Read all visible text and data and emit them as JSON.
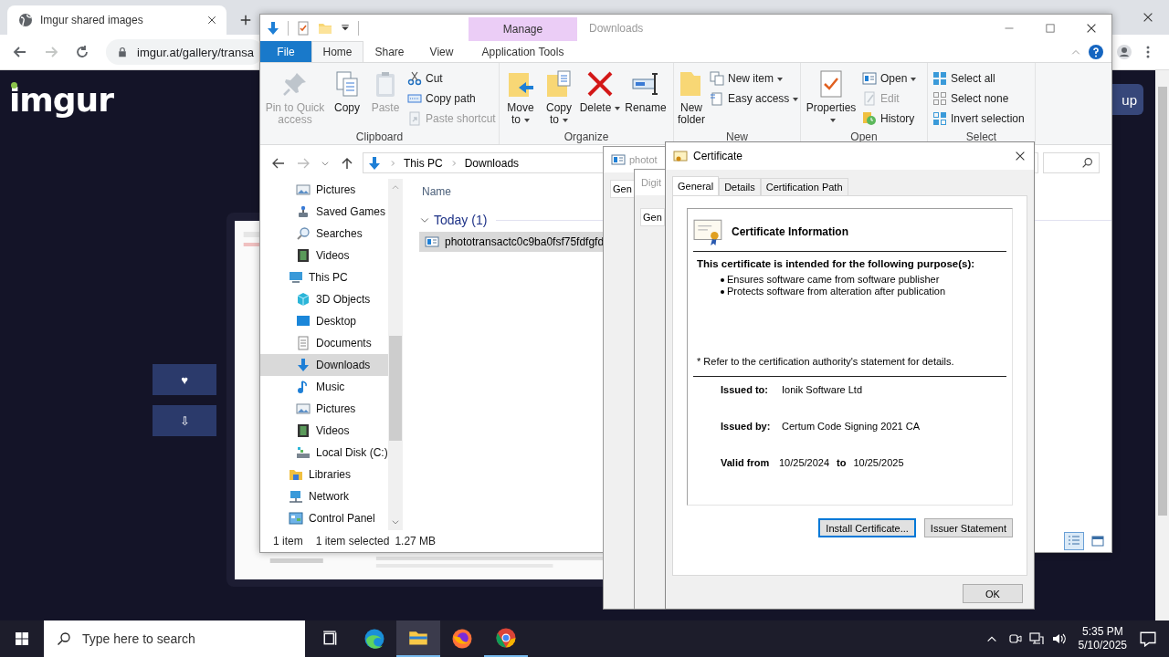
{
  "browser": {
    "tab_title": "Imgur shared images",
    "url": "imgur.at/gallery/transa",
    "logo": "imgur",
    "header_button": "up",
    "page_buttons": [
      "♥",
      "⇩"
    ]
  },
  "explorer": {
    "title": "Downloads",
    "context_group": "Manage",
    "ribbon_tabs": [
      {
        "label": "File",
        "kind": "file",
        "selected": false
      },
      {
        "label": "Home",
        "kind": "tab",
        "selected": true
      },
      {
        "label": "Share",
        "kind": "tab",
        "selected": false
      },
      {
        "label": "View",
        "kind": "tab",
        "selected": false
      },
      {
        "label": "Application Tools",
        "kind": "context",
        "selected": false
      }
    ],
    "ribbon_groups": [
      {
        "label": "Clipboard",
        "large": [
          {
            "label": "Pin to Quick access",
            "disabled": true,
            "menu": false
          },
          {
            "label": "Copy",
            "disabled": false,
            "menu": false
          },
          {
            "label": "Paste",
            "disabled": true,
            "menu": false
          }
        ],
        "small": [
          {
            "label": "Cut",
            "disabled": false,
            "menu": false
          },
          {
            "label": "Copy path",
            "disabled": false,
            "menu": false
          },
          {
            "label": "Paste shortcut",
            "disabled": true,
            "menu": false
          }
        ]
      },
      {
        "label": "Organize",
        "large": [
          {
            "label": "Move to",
            "disabled": false,
            "menu": true
          },
          {
            "label": "Copy to",
            "disabled": false,
            "menu": true
          },
          {
            "label": "Delete",
            "disabled": false,
            "menu": true
          },
          {
            "label": "Rename",
            "disabled": false,
            "menu": false
          }
        ]
      },
      {
        "label": "New",
        "large": [
          {
            "label": "New folder",
            "disabled": false,
            "menu": false
          }
        ],
        "small": [
          {
            "label": "New item",
            "disabled": false,
            "menu": true
          },
          {
            "label": "Easy access",
            "disabled": false,
            "menu": true
          }
        ]
      },
      {
        "label": "Open",
        "large": [
          {
            "label": "Properties",
            "disabled": false,
            "menu": true
          }
        ],
        "small": [
          {
            "label": "Open",
            "disabled": false,
            "menu": true
          },
          {
            "label": "Edit",
            "disabled": true,
            "menu": false
          },
          {
            "label": "History",
            "disabled": false,
            "menu": false
          }
        ]
      },
      {
        "label": "Select",
        "small": [
          {
            "label": "Select all",
            "disabled": false,
            "menu": false
          },
          {
            "label": "Select none",
            "disabled": false,
            "menu": false
          },
          {
            "label": "Invert selection",
            "disabled": false,
            "menu": false
          }
        ]
      }
    ],
    "breadcrumb": [
      "This PC",
      "Downloads"
    ],
    "nav_tree": {
      "items_of_hidden_parent": [
        {
          "label": "Pictures",
          "selected": false
        },
        {
          "label": "Saved Games",
          "selected": false
        },
        {
          "label": "Searches",
          "selected": false
        },
        {
          "label": "Videos",
          "selected": false
        }
      ],
      "items": [
        {
          "label": "This PC",
          "selected": false,
          "children": [
            {
              "label": "3D Objects",
              "selected": false
            },
            {
              "label": "Desktop",
              "selected": false
            },
            {
              "label": "Documents",
              "selected": false
            },
            {
              "label": "Downloads",
              "selected": true
            },
            {
              "label": "Music",
              "selected": false
            },
            {
              "label": "Pictures",
              "selected": false
            },
            {
              "label": "Videos",
              "selected": false
            },
            {
              "label": "Local Disk (C:)",
              "selected": false
            }
          ]
        },
        {
          "label": "Libraries",
          "selected": false
        },
        {
          "label": "Network",
          "selected": false
        },
        {
          "label": "Control Panel",
          "selected": false
        }
      ]
    },
    "file_list": {
      "column": "Name",
      "groups": [
        {
          "label": "Today (1)",
          "expanded": true,
          "files": [
            {
              "name": "phototransactc0c9ba0fsf75fdfgfd",
              "selected": true
            }
          ]
        }
      ]
    },
    "status": [
      "1 item",
      "1 item selected",
      "1.27 MB"
    ],
    "view_modes": [
      {
        "selected": true
      },
      {
        "selected": false
      }
    ]
  },
  "back_dialogs": [
    {
      "title": "photot",
      "tab": "Gen"
    },
    {
      "title": "Digit",
      "tab": "Gen"
    }
  ],
  "certificate": {
    "title": "Certificate",
    "tabs": [
      {
        "label": "General",
        "selected": true
      },
      {
        "label": "Details",
        "selected": false
      },
      {
        "label": "Certification Path",
        "selected": false
      }
    ],
    "heading": "Certificate Information",
    "purpose_heading": "This certificate is intended for the following purpose(s):",
    "purposes": [
      "Ensures software came from software publisher",
      "Protects software from alteration after publication"
    ],
    "note": "* Refer to the certification authority's statement for details.",
    "issued_to_label": "Issued to:",
    "issued_to": "Ionik Software Ltd",
    "issued_by_label": "Issued by:",
    "issued_by": "Certum Code Signing 2021 CA",
    "valid_from_label": "Valid from",
    "valid_from": "10/25/2024",
    "valid_to_label": "to",
    "valid_to": "10/25/2025",
    "buttons": [
      {
        "label": "Install Certificate...",
        "focused": true
      },
      {
        "label": "Issuer Statement",
        "focused": false
      }
    ],
    "ok": "OK"
  },
  "taskbar": {
    "search_placeholder": "Type here to search",
    "apps": [
      {
        "selected": false,
        "running": false
      },
      {
        "selected": true,
        "running": true
      },
      {
        "selected": false,
        "running": false
      },
      {
        "selected": false,
        "running": true
      }
    ],
    "time": "5:35 PM",
    "date": "5/10/2025"
  }
}
